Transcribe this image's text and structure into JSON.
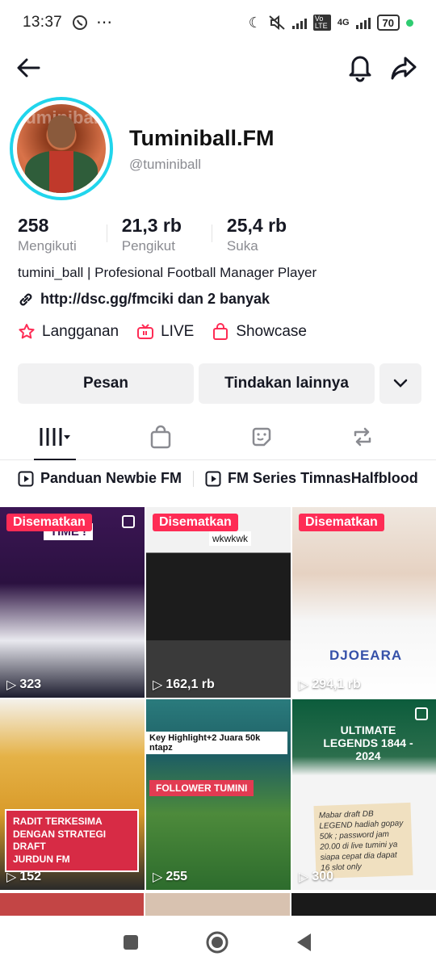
{
  "status_bar": {
    "time": "13:37",
    "battery": "70",
    "network": "4G",
    "volte": "Vo LTE"
  },
  "profile": {
    "name": "Tuminiball.FM",
    "handle": "@tuminiball",
    "avatar_watermark": "tuminiball",
    "bio": "tumini_ball | Profesional Football Manager Player",
    "link": "http://dsc.gg/fmciki dan 2 banyak"
  },
  "stats": [
    {
      "value": "258",
      "label": "Mengikuti"
    },
    {
      "value": "21,3 rb",
      "label": "Pengikut"
    },
    {
      "value": "25,4 rb",
      "label": "Suka"
    }
  ],
  "chips": {
    "subscribe": "Langganan",
    "live": "LIVE",
    "showcase": "Showcase"
  },
  "actions": {
    "message": "Pesan",
    "more": "Tindakan lainnya"
  },
  "playlists": [
    "Panduan Newbie FM",
    "FM Series TimnasHalfblood"
  ],
  "videos": [
    {
      "pinned": "Disematkan",
      "views": "323",
      "overlay": "TIME !"
    },
    {
      "pinned": "Disematkan",
      "views": "162,1 rb",
      "overlay": "wkwkwk"
    },
    {
      "pinned": "Disematkan",
      "views": "294,1 rb",
      "overlay": "DJOEARA"
    },
    {
      "views": "152",
      "overlay_lines": [
        "RADIT TERKESIMA",
        "DENGAN STRATEGI DRAFT",
        "JURDUN FM"
      ]
    },
    {
      "views": "255",
      "overlay": "Key Highlight+2 Juara 50k ntapz",
      "overlay2": "FOLLOWER TUMINI"
    },
    {
      "views": "300",
      "overlay": "ULTIMATE LEGENDS 1844 - 2024",
      "note": "Mabar draft DB LEGEND hadiah gopay 50k ; password jam 20.00 di live tumini ya siapa cepat dia dapat 16 slot only"
    }
  ],
  "colors": {
    "accent": "#fe2c55",
    "ring": "#20d5ec",
    "text": "#161823",
    "muted": "#8a8b91"
  }
}
